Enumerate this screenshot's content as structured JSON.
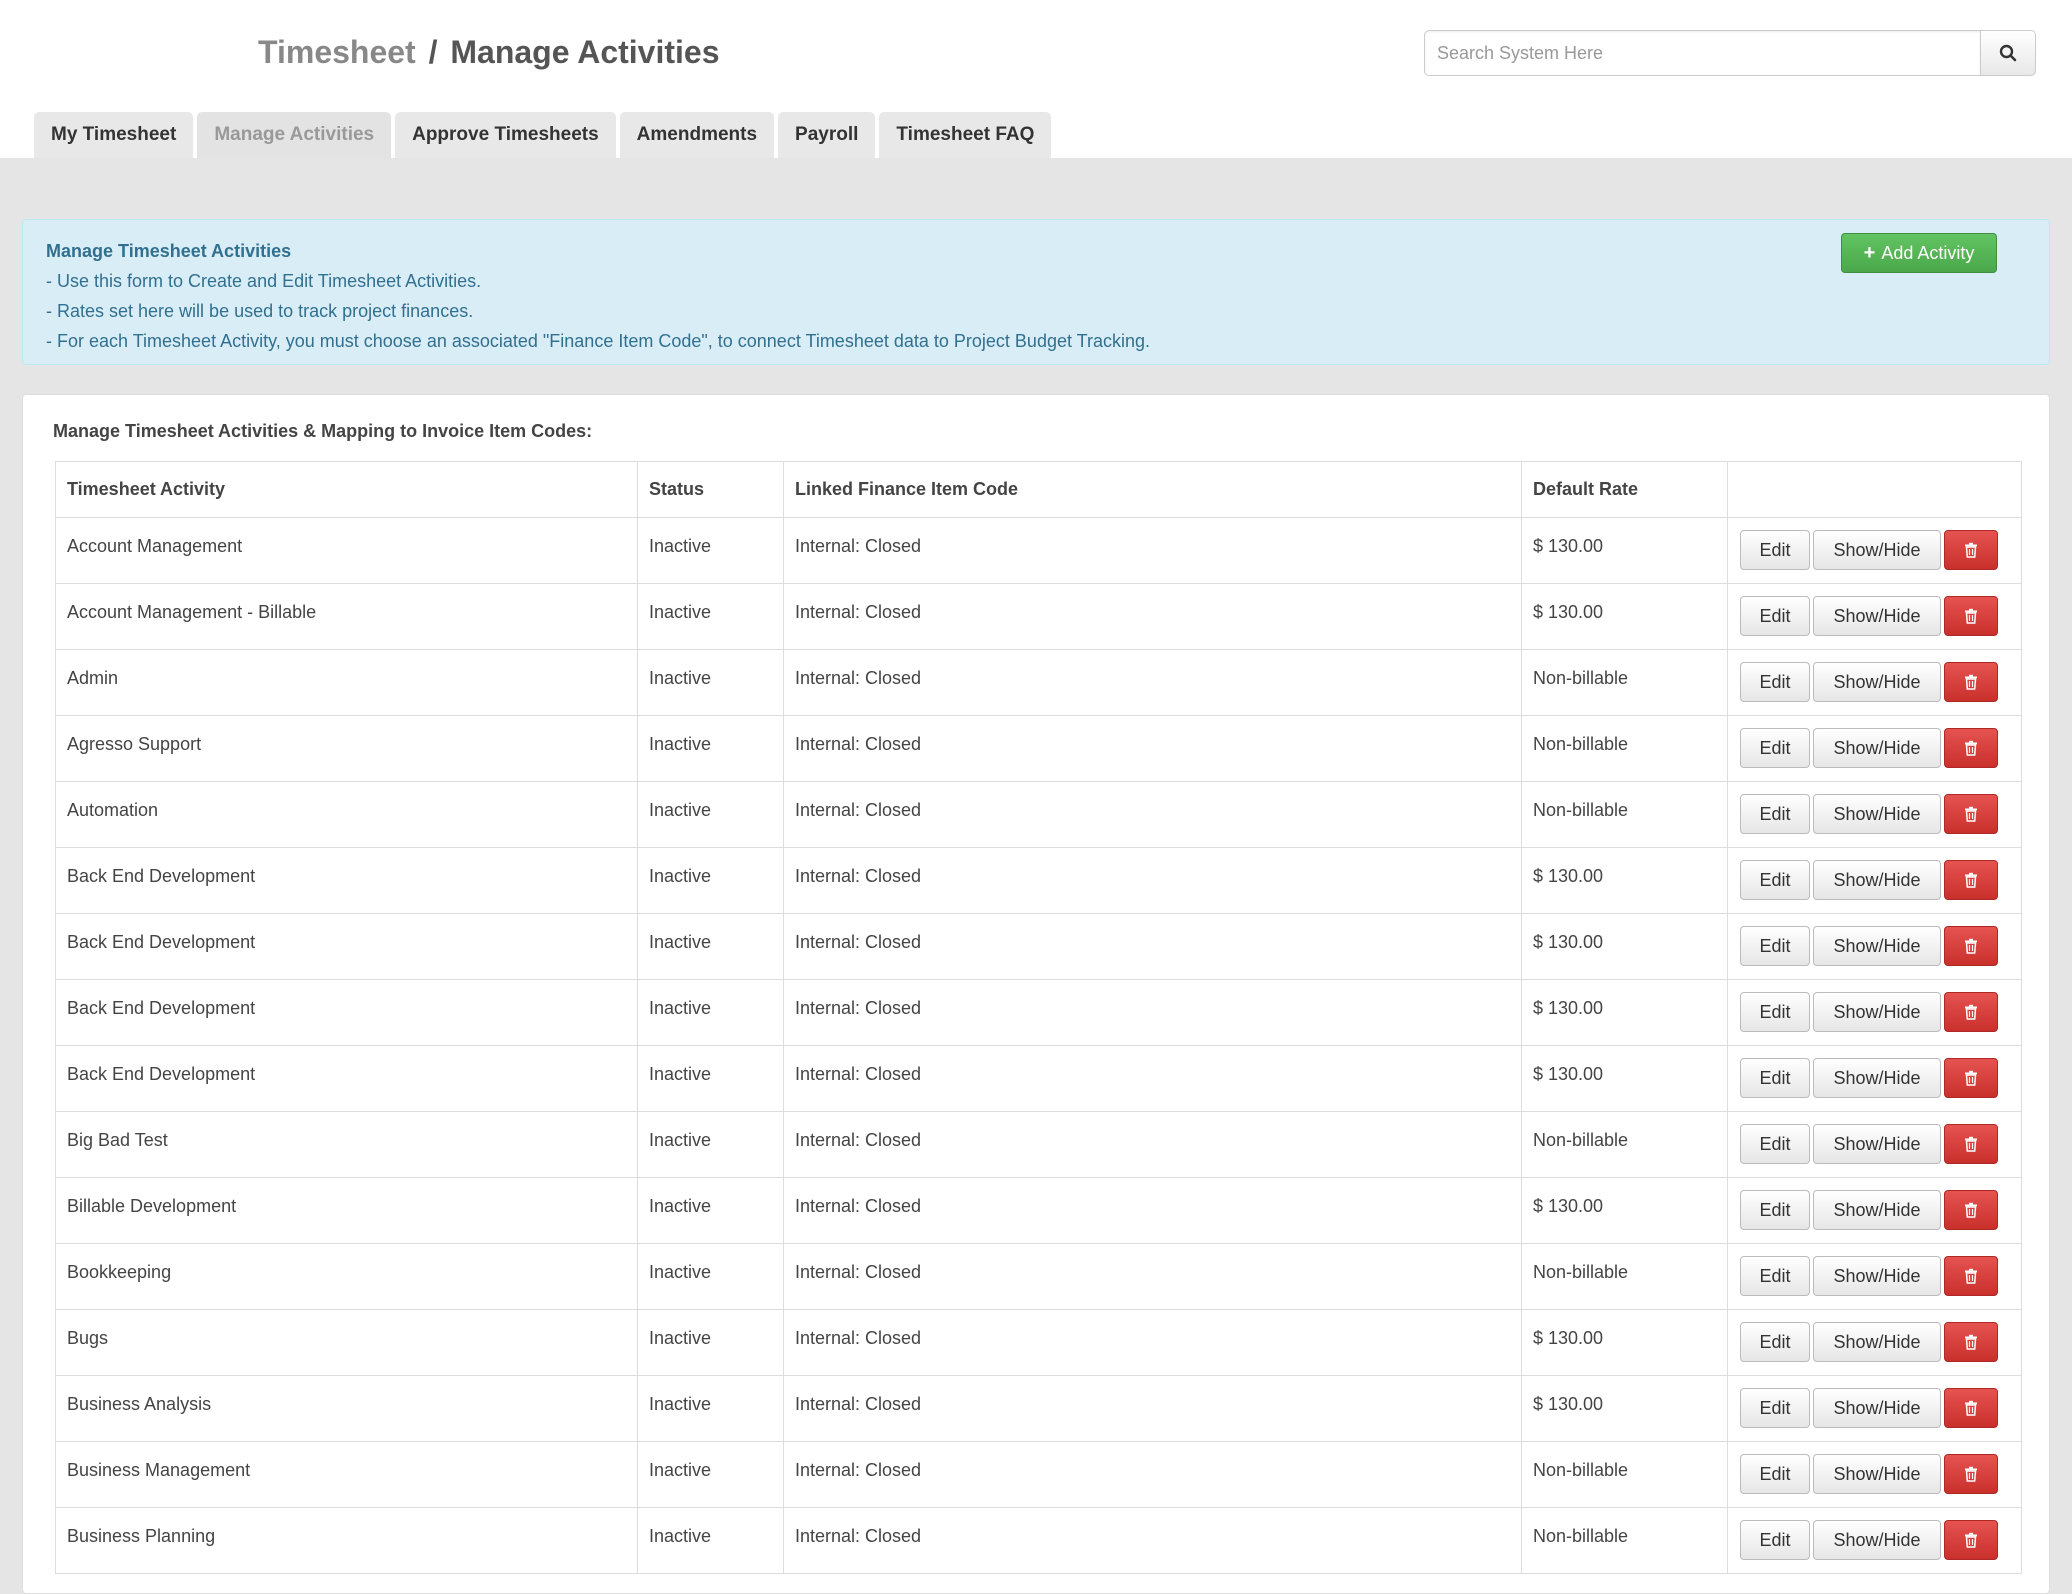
{
  "header": {
    "crumb": "Timesheet",
    "separator": "/",
    "title": "Manage Activities",
    "search_placeholder": "Search System Here",
    "search_icon": "search-icon"
  },
  "tabs": [
    {
      "label": "My Timesheet",
      "active": false
    },
    {
      "label": "Manage Activities",
      "active": true
    },
    {
      "label": "Approve Timesheets",
      "active": false
    },
    {
      "label": "Amendments",
      "active": false
    },
    {
      "label": "Payroll",
      "active": false
    },
    {
      "label": "Timesheet FAQ",
      "active": false
    }
  ],
  "info": {
    "heading": "Manage Timesheet Activities",
    "lines": [
      "- Use this form to Create and Edit Timesheet Activities.",
      "- Rates set here will be used to track project finances.",
      "- For each Timesheet Activity, you must choose an associated \"Finance Item Code\", to connect Timesheet data to Project Budget Tracking."
    ],
    "add_label": "Add Activity"
  },
  "panel": {
    "heading": "Manage Timesheet Activities & Mapping to Invoice Item Codes:"
  },
  "table": {
    "headers": [
      "Timesheet Activity",
      "Status",
      "Linked Finance Item Code",
      "Default Rate",
      ""
    ],
    "edit_label": "Edit",
    "show_label": "Show/Hide",
    "delete_icon": "trash-icon",
    "rows": [
      {
        "activity": "Account Management",
        "status": "Inactive",
        "code": "Internal: Closed",
        "rate": "$ 130.00"
      },
      {
        "activity": "Account Management - Billable",
        "status": "Inactive",
        "code": "Internal: Closed",
        "rate": "$ 130.00"
      },
      {
        "activity": "Admin",
        "status": "Inactive",
        "code": "Internal: Closed",
        "rate": "Non-billable"
      },
      {
        "activity": "Agresso Support",
        "status": "Inactive",
        "code": "Internal: Closed",
        "rate": "Non-billable"
      },
      {
        "activity": "Automation",
        "status": "Inactive",
        "code": "Internal: Closed",
        "rate": "Non-billable"
      },
      {
        "activity": "Back End Development",
        "status": "Inactive",
        "code": "Internal: Closed",
        "rate": "$ 130.00"
      },
      {
        "activity": "Back End Development",
        "status": "Inactive",
        "code": "Internal: Closed",
        "rate": "$ 130.00"
      },
      {
        "activity": "Back End Development",
        "status": "Inactive",
        "code": "Internal: Closed",
        "rate": "$ 130.00"
      },
      {
        "activity": "Back End Development",
        "status": "Inactive",
        "code": "Internal: Closed",
        "rate": "$ 130.00"
      },
      {
        "activity": "Big Bad Test",
        "status": "Inactive",
        "code": "Internal: Closed",
        "rate": "Non-billable"
      },
      {
        "activity": "Billable Development",
        "status": "Inactive",
        "code": "Internal: Closed",
        "rate": "$ 130.00"
      },
      {
        "activity": "Bookkeeping",
        "status": "Inactive",
        "code": "Internal: Closed",
        "rate": "Non-billable"
      },
      {
        "activity": "Bugs",
        "status": "Inactive",
        "code": "Internal: Closed",
        "rate": "$ 130.00"
      },
      {
        "activity": "Business Analysis",
        "status": "Inactive",
        "code": "Internal: Closed",
        "rate": "$ 130.00"
      },
      {
        "activity": "Business Management",
        "status": "Inactive",
        "code": "Internal: Closed",
        "rate": "Non-billable"
      },
      {
        "activity": "Business Planning",
        "status": "Inactive",
        "code": "Internal: Closed",
        "rate": "Non-billable"
      }
    ]
  }
}
